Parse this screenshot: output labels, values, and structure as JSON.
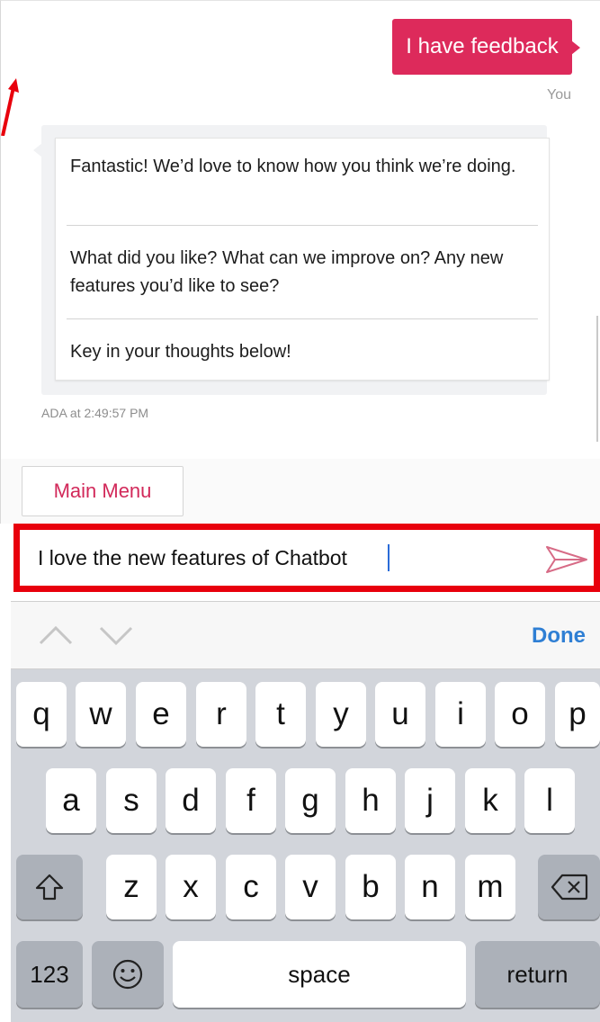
{
  "chat": {
    "user_message": "I have feedback",
    "user_label": "You",
    "bot_messages": [
      "Fantastic! We’d love to know how you think we’re doing.",
      "What did you like? What can we improve on? Any new features you’d like to see?",
      "Key in your thoughts below!"
    ],
    "bot_timestamp": "ADA at 2:49:57 PM"
  },
  "menu": {
    "main_menu_label": "Main Menu"
  },
  "composer": {
    "value": "I love the new features of Chatbot"
  },
  "keyboard": {
    "done_label": "Done",
    "row1": [
      "q",
      "w",
      "e",
      "r",
      "t",
      "y",
      "u",
      "i",
      "o",
      "p"
    ],
    "row2": [
      "a",
      "s",
      "d",
      "f",
      "g",
      "h",
      "j",
      "k",
      "l"
    ],
    "row3": [
      "z",
      "x",
      "c",
      "v",
      "b",
      "n",
      "m"
    ],
    "numbers_label": "123",
    "space_label": "space",
    "return_label": "return"
  },
  "colors": {
    "accent": "#dd2a5b",
    "highlight": "#e8000c",
    "done_blue": "#2f7fd4",
    "keyboard_bg": "#d2d5db"
  },
  "icons": {
    "send": "send-icon",
    "shift": "shift-icon",
    "delete": "delete-icon",
    "emoji": "emoji-icon",
    "up": "chevron-up-icon",
    "down": "chevron-down-icon"
  }
}
